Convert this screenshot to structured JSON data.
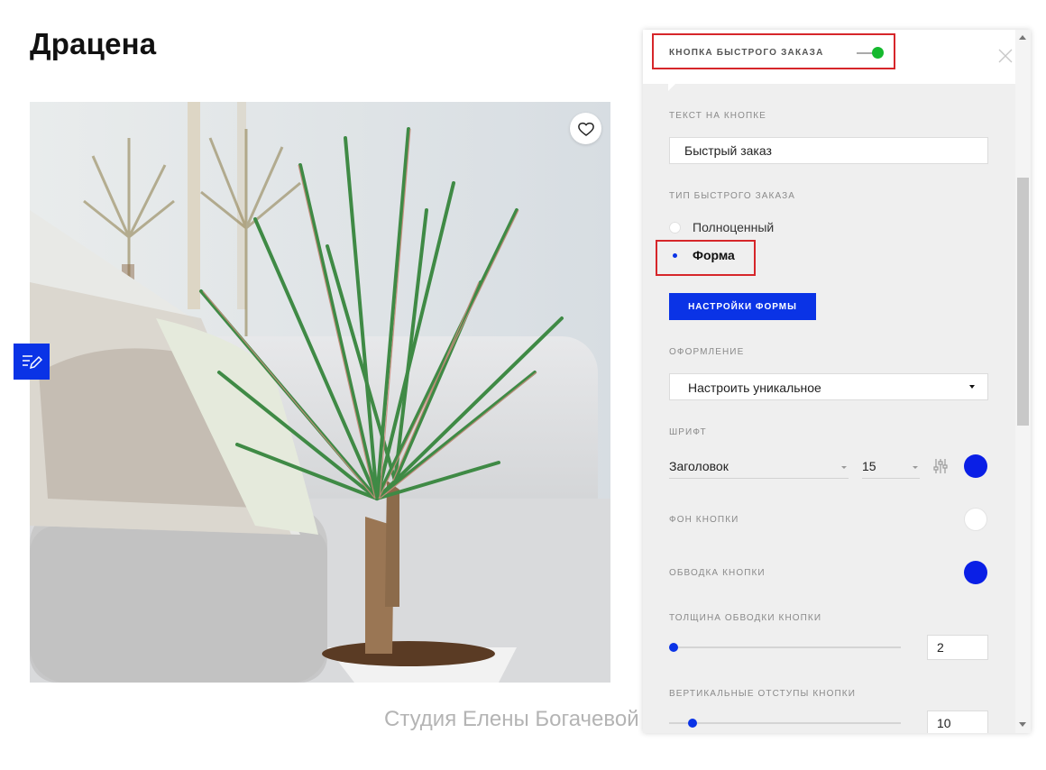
{
  "product": {
    "title": "Драцена",
    "caption": "Студия Елены Богачевой"
  },
  "icons": {
    "favorite": "heart-icon",
    "edit": "edit-block-icon",
    "close": "close-icon",
    "typography": "sliders-icon"
  },
  "panel": {
    "header_label": "КНОПКА БЫСТРОГО ЗАКАЗА",
    "toggle_on": true,
    "button_text_label": "ТЕКСТ НА КНОПКЕ",
    "button_text_value": "Быстрый заказ",
    "order_type_label": "ТИП БЫСТРОГО ЗАКАЗА",
    "order_type_options": [
      "Полноценный",
      "Форма"
    ],
    "order_type_selected": "Форма",
    "form_settings_button": "НАСТРОЙКИ ФОРМЫ",
    "design_label": "ОФОРМЛЕНИЕ",
    "design_value": "Настроить уникальное",
    "font_label": "ШРИФТ",
    "font_family": "Заголовок",
    "font_size": "15",
    "background_label": "ФОН КНОПКИ",
    "border_label": "ОБВОДКА КНОПКИ",
    "border_width_label": "ТОЛЩИНА ОБВОДКИ КНОПКИ",
    "border_width_value": "2",
    "vertical_padding_label": "ВЕРТИКАЛЬНЫЕ ОТСТУПЫ КНОПКИ",
    "vertical_padding_value": "10"
  },
  "colors": {
    "accent": "#0a33e6",
    "toggle_on": "#15b92e",
    "highlight": "#d6262a",
    "font_color": "#0a1fe6",
    "button_background": "#ffffff",
    "button_border": "#0a1fe6"
  }
}
